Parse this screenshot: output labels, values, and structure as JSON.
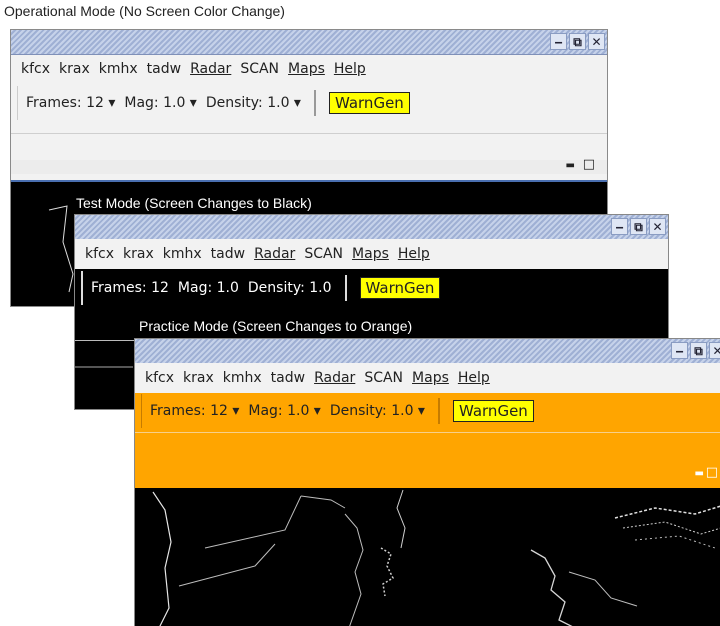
{
  "captions": {
    "operational": "Operational Mode (No Screen Color Change)",
    "test": "Test Mode (Screen Changes to Black)",
    "practice": "Practice Mode (Screen Changes to Orange)"
  },
  "menu": {
    "items": [
      "kfcx",
      "krax",
      "kmhx",
      "tadw",
      "Radar",
      "SCAN",
      "Maps",
      "Help"
    ]
  },
  "title_buttons": {
    "minimize": "‒",
    "restore": "⧉",
    "close": "✕"
  },
  "panel_buttons": {
    "minimize": "▬",
    "maximize": "□"
  },
  "toolbar_operational": {
    "frames": "Frames: 12 ▾",
    "mag": "Mag: 1.0 ▾",
    "density": "Density: 1.0 ▾",
    "warngen": "WarnGen"
  },
  "toolbar_test": {
    "frames": "Frames: 12",
    "mag": "Mag: 1.0",
    "density": "Density: 1.0",
    "warngen": "WarnGen"
  },
  "toolbar_practice": {
    "frames": "Frames: 12 ▾",
    "mag": "Mag: 1.0 ▾",
    "density": "Density: 1.0 ▾",
    "warngen": "WarnGen"
  },
  "colors": {
    "test_bg": "#000000",
    "practice_bg": "#ffa500",
    "warngen": "#ffff00",
    "operational_bg": "#f2f2f2"
  }
}
